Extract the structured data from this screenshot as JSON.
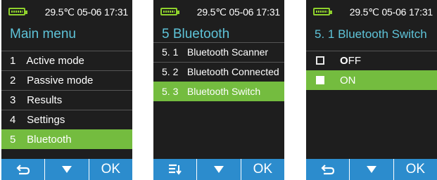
{
  "status": {
    "temperature": "29.5℃",
    "date": "05-06",
    "time": "17:31"
  },
  "screens": [
    {
      "title": "Main menu",
      "items": [
        {
          "num": "1",
          "label": "Active mode"
        },
        {
          "num": "2",
          "label": "Passive mode"
        },
        {
          "num": "3",
          "label": "Results"
        },
        {
          "num": "4",
          "label": "Settings"
        },
        {
          "num": "5",
          "label": "Bluetooth"
        }
      ],
      "selected_index": 4,
      "buttons": {
        "left_icon": "back-arrow-icon",
        "middle_icon": "down-triangle-icon",
        "ok": "OK"
      }
    },
    {
      "title": "5 Bluetooth",
      "items": [
        {
          "num": "5. 1",
          "label": "Bluetooth Scanner"
        },
        {
          "num": "5. 2",
          "label": "Bluetooth Connected"
        },
        {
          "num": "5. 3",
          "label": "Bluetooth Switch"
        }
      ],
      "selected_index": 2,
      "buttons": {
        "left_icon": "menu-list-icon",
        "middle_icon": "down-triangle-icon",
        "ok": "OK"
      }
    },
    {
      "title": "5. 1 Bluetooth Switch",
      "options": [
        {
          "label_first": "O",
          "label_rest": "FF",
          "checked": false
        },
        {
          "label_first": "",
          "label_rest": "ON",
          "checked": true
        }
      ],
      "selected_index": 1,
      "buttons": {
        "left_icon": "back-arrow-icon",
        "middle_icon": "down-triangle-icon",
        "ok": "OK"
      }
    }
  ],
  "colors": {
    "accent_title": "#5ec3d8",
    "selection": "#74bc3f",
    "button_bar": "#2c8ccd",
    "battery": "#8fd12c",
    "background": "#1e1e1e"
  }
}
